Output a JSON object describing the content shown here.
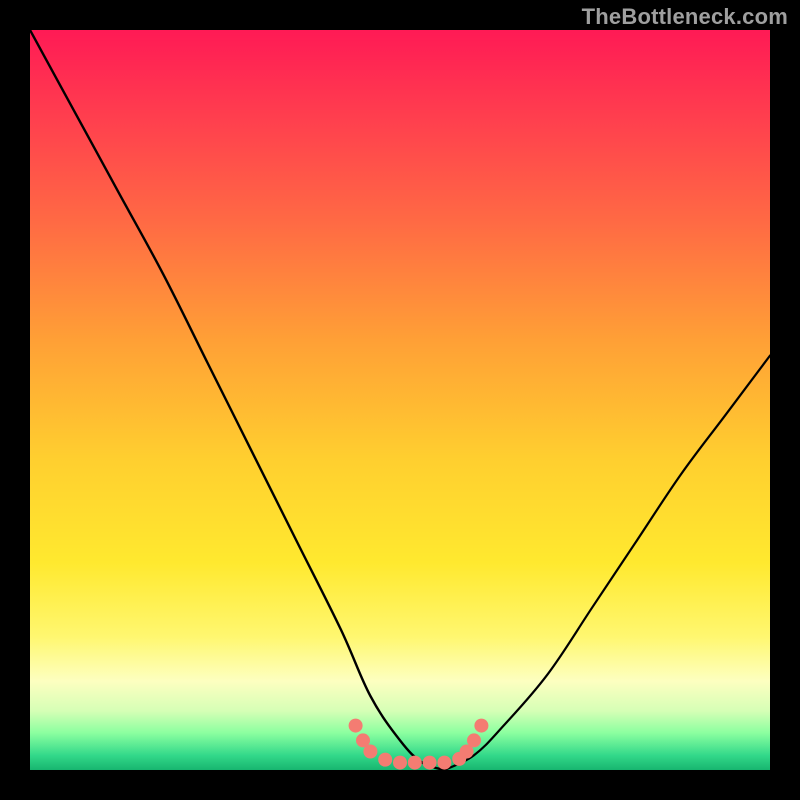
{
  "watermark": "TheBottleneck.com",
  "chart_data": {
    "type": "line",
    "title": "",
    "xlabel": "",
    "ylabel": "",
    "xlim": [
      0,
      100
    ],
    "ylim": [
      0,
      100
    ],
    "grid": false,
    "legend": false,
    "series": [
      {
        "name": "bottleneck-curve-left",
        "x": [
          0,
          6,
          12,
          18,
          24,
          30,
          36,
          42,
          46,
          50,
          53,
          56
        ],
        "y": [
          100,
          89,
          78,
          67,
          55,
          43,
          31,
          19,
          10,
          4,
          1,
          0
        ]
      },
      {
        "name": "bottleneck-curve-right",
        "x": [
          56,
          60,
          64,
          70,
          76,
          82,
          88,
          94,
          100
        ],
        "y": [
          0,
          2,
          6,
          13,
          22,
          31,
          40,
          48,
          56
        ]
      }
    ],
    "markers": {
      "name": "highlight-points",
      "color": "#f47c72",
      "points": [
        {
          "x": 44,
          "y": 6
        },
        {
          "x": 45,
          "y": 4
        },
        {
          "x": 46,
          "y": 2.5
        },
        {
          "x": 48,
          "y": 1.4
        },
        {
          "x": 50,
          "y": 1
        },
        {
          "x": 52,
          "y": 1
        },
        {
          "x": 54,
          "y": 1
        },
        {
          "x": 56,
          "y": 1
        },
        {
          "x": 58,
          "y": 1.5
        },
        {
          "x": 59,
          "y": 2.5
        },
        {
          "x": 60,
          "y": 4
        },
        {
          "x": 61,
          "y": 6
        }
      ]
    },
    "colors": {
      "curve": "#000000",
      "marker": "#f47c72",
      "background_top": "#ff1a55",
      "background_bottom": "#17b56f",
      "frame": "#000000"
    }
  }
}
